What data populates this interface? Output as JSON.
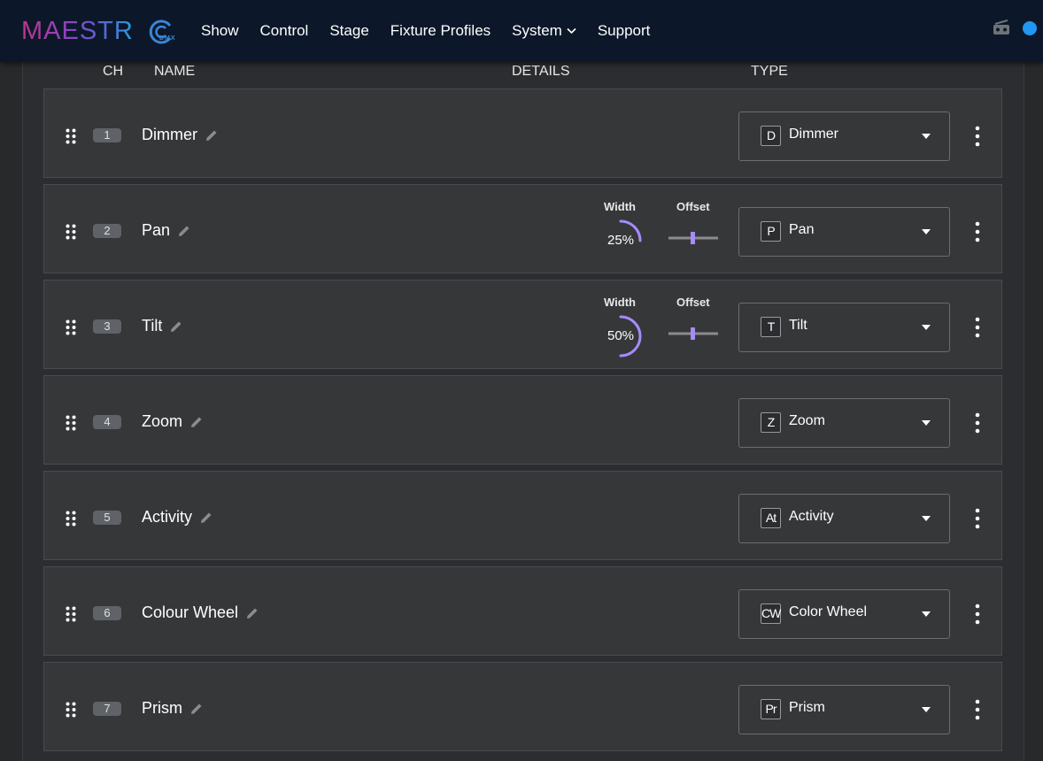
{
  "app": {
    "logo_text": "MAESTR",
    "logo_sub": "DMX",
    "nav": [
      "Show",
      "Control",
      "Stage",
      "Fixture Profiles",
      "System",
      "Support"
    ],
    "status_color": "#2196f3",
    "accent_color": "#a78bfa"
  },
  "columns": {
    "ch": "CH",
    "name": "NAME",
    "details": "DETAILS",
    "type": "TYPE"
  },
  "details_labels": {
    "width": "Width",
    "offset": "Offset"
  },
  "channels": [
    {
      "ch": "1",
      "name": "Dimmer",
      "type_abbr": "D",
      "type": "Dimmer"
    },
    {
      "ch": "2",
      "name": "Pan",
      "type_abbr": "P",
      "type": "Pan",
      "width": "25%",
      "width_fraction": 0.25,
      "offset_fraction": 0.5
    },
    {
      "ch": "3",
      "name": "Tilt",
      "type_abbr": "T",
      "type": "Tilt",
      "width": "50%",
      "width_fraction": 0.5,
      "offset_fraction": 0.5
    },
    {
      "ch": "4",
      "name": "Zoom",
      "type_abbr": "Z",
      "type": "Zoom"
    },
    {
      "ch": "5",
      "name": "Activity",
      "type_abbr": "At",
      "type": "Activity"
    },
    {
      "ch": "6",
      "name": "Colour Wheel",
      "type_abbr": "CW",
      "type": "Color Wheel"
    },
    {
      "ch": "7",
      "name": "Prism",
      "type_abbr": "Pr",
      "type": "Prism"
    }
  ]
}
